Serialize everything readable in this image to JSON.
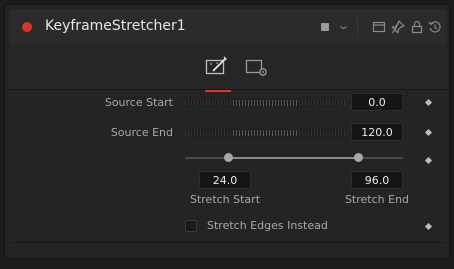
{
  "header": {
    "title": "KeyframeStretcher1",
    "icons": [
      "record-dot-icon",
      "color-swatch-icon",
      "chevron-down-icon",
      "window-icon",
      "pin-icon",
      "lock-icon",
      "reset-icon"
    ],
    "accent": "#e0322e"
  },
  "tabs": [
    {
      "name": "controls",
      "icon": "wand-tab-icon",
      "active": true
    },
    {
      "name": "settings",
      "icon": "settings-tab-icon",
      "active": false
    }
  ],
  "controls": {
    "source_start": {
      "label": "Source Start",
      "value": "0.0"
    },
    "source_end": {
      "label": "Source End",
      "value": "120.0"
    },
    "stretch_start": {
      "label": "Stretch Start",
      "value": "24.0"
    },
    "stretch_end": {
      "label": "Stretch End",
      "value": "96.0"
    },
    "stretch_edges": {
      "label": "Stretch Edges Instead",
      "checked": false
    }
  }
}
